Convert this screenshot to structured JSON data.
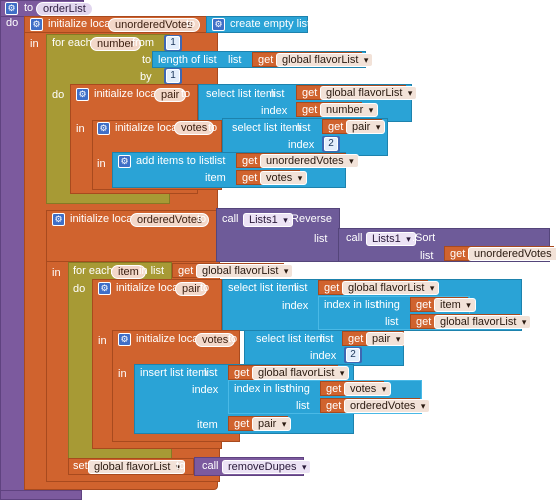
{
  "procedure": {
    "to": "to",
    "name": "orderList",
    "do": "do"
  },
  "words": {
    "initialize_local": "initialize local",
    "to": "to",
    "in": "in",
    "do": "do",
    "for_each": "for each",
    "from": "from",
    "by": "by",
    "in_list": "in list",
    "get": "get",
    "list": "list",
    "index": "index",
    "item": "item",
    "thing": "thing",
    "set": "set",
    "call": "call"
  },
  "blocks": {
    "create_empty_list": "create empty list",
    "length_of_list": "length of list",
    "select_list_item": "select list item",
    "add_items_to_list": "add items to list",
    "index_in_list": "index in list",
    "insert_list_item": "insert list item",
    "reverse": ".Reverse",
    "sort": ".Sort"
  },
  "vars": {
    "unorderedVotes": "unorderedVotes",
    "number": "number",
    "pair": "pair",
    "votes": "votes",
    "orderedVotes": "orderedVotes",
    "item": "item",
    "global_flavorList": "global flavorList",
    "removeDupes": "removeDupes",
    "Lists1": "Lists1"
  },
  "numbers": {
    "one": "1",
    "two": "2"
  },
  "colors": {
    "procedure": "#7c5a9e",
    "variables": "#d0632e",
    "lists": "#2aa3d6",
    "control": "#a79a35",
    "component": "#6e5b99",
    "math": "#3e67b2"
  }
}
